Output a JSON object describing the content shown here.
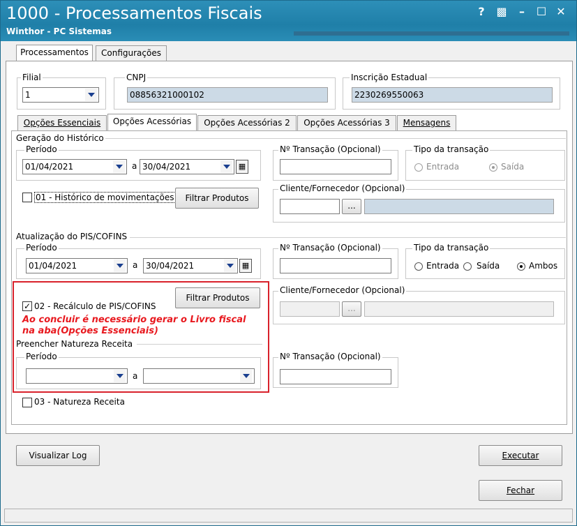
{
  "window": {
    "title": "1000 - Processamentos Fiscais",
    "subtitle": "Winthor - PC Sistemas",
    "controls": {
      "help": "?",
      "restore": "▩",
      "minimize": "–",
      "maximize": "☐",
      "close": "✕"
    }
  },
  "main_tabs": [
    {
      "label": "Processamentos",
      "selected": true
    },
    {
      "label": "Configurações",
      "selected": false
    }
  ],
  "top": {
    "filial": {
      "label": "Filial",
      "value": "1"
    },
    "cnpj": {
      "label": "CNPJ",
      "value": "08856321000102"
    },
    "ie": {
      "label": "Inscrição Estadual",
      "value": "2230269550063"
    }
  },
  "sub_tabs": [
    {
      "label": "Opções Essenciais",
      "selected": false
    },
    {
      "label": "Opções Acessórias",
      "selected": true
    },
    {
      "label": "Opções Acessórias 2",
      "selected": false
    },
    {
      "label": "Opções Acessórias 3",
      "selected": false
    },
    {
      "label": "Mensagens",
      "selected": false
    }
  ],
  "historico": {
    "title": "Geração do Histórico",
    "periodo_label": "Período",
    "date_from": "01/04/2021",
    "date_sep": "a",
    "date_to": "30/04/2021",
    "check_label": "01 - Histórico de movimentações",
    "checked": false,
    "filtrar_label": "Filtrar Produtos",
    "ntrans_label": "Nº Transação (Opcional)",
    "ntrans_value": "",
    "tipo_label": "Tipo da transação",
    "radio_entrada": "Entrada",
    "radio_saida": "Saída",
    "selected": "saida",
    "cliente_label": "Cliente/Fornecedor (Opcional)",
    "cliente_btn": "..."
  },
  "pis": {
    "title": "Atualização do PIS/COFINS",
    "periodo_label": "Período",
    "date_from": "01/04/2021",
    "date_sep": "a",
    "date_to": "30/04/2021",
    "ntrans_label": "Nº Transação (Opcional)",
    "tipo_label": "Tipo da transação",
    "radio_entrada": "Entrada",
    "radio_saida": "Saída",
    "radio_ambos": "Ambos",
    "selected": "ambos",
    "filtrar_label": "Filtrar Produtos",
    "check_label": "02 - Recálculo de PIS/COFINS",
    "checked": true,
    "warning": "Ao concluir é necessário gerar o Livro fiscal na aba(Opções Essenciais)",
    "cliente_label": "Cliente/Fornecedor (Opcional)",
    "cliente_btn": "..."
  },
  "natureza": {
    "title": "Preencher Natureza Receita",
    "periodo_label": "Período",
    "date_sep": "a",
    "ntrans_label": "Nº Transação (Opcional)",
    "check_label": "03 - Natureza Receita",
    "checked": false
  },
  "footer": {
    "visualizar_log": "Visualizar Log",
    "executar": "Executar",
    "fechar": "Fechar"
  },
  "colors": {
    "title_bar": "#1f7fa8",
    "warning": "#e8191f",
    "highlight_box": "#d9212b",
    "readonly_field": "#ccdae6"
  },
  "icons": {
    "dropdown": "chevron-down-icon",
    "calendar": "calendar-icon"
  }
}
